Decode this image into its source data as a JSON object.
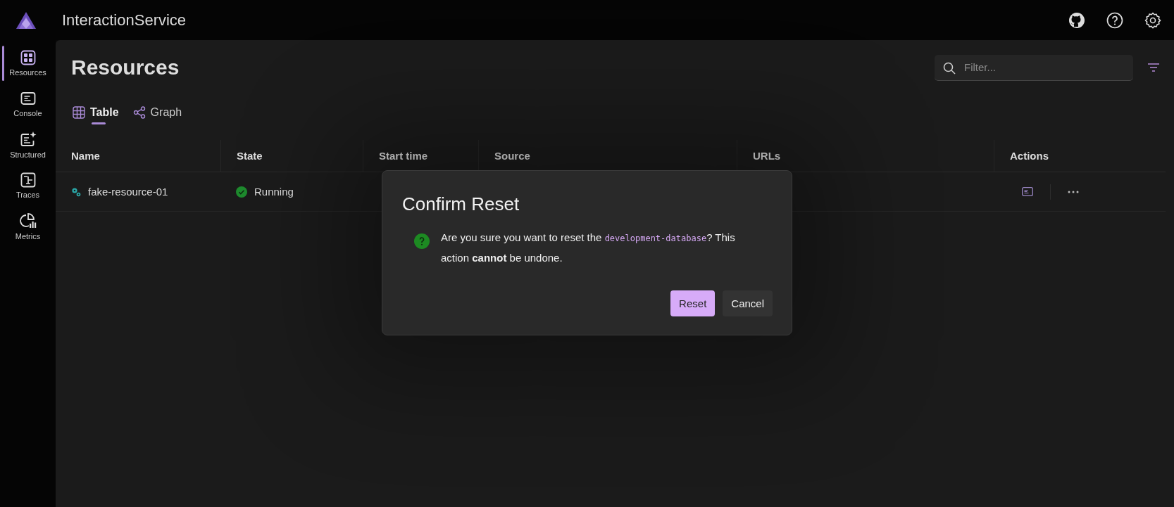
{
  "header": {
    "title": "InteractionService"
  },
  "nav": [
    {
      "label": "Resources",
      "selected": true
    },
    {
      "label": "Console",
      "selected": false
    },
    {
      "label": "Structured",
      "selected": false
    },
    {
      "label": "Traces",
      "selected": false
    },
    {
      "label": "Metrics",
      "selected": false
    }
  ],
  "page": {
    "title": "Resources",
    "filter": {
      "placeholder": "Filter..."
    }
  },
  "views": [
    {
      "label": "Table",
      "selected": true
    },
    {
      "label": "Graph",
      "selected": false
    }
  ],
  "table": {
    "columns": [
      "Name",
      "State",
      "Start time",
      "Source",
      "URLs",
      "Actions"
    ],
    "rows": [
      {
        "name": "fake-resource-01",
        "state": "Running"
      }
    ]
  },
  "dialog": {
    "title": "Confirm Reset",
    "message": [
      {
        "kind": "text",
        "text": "Are you sure you want to reset the "
      },
      {
        "kind": "code",
        "text": "development-database"
      },
      {
        "kind": "text",
        "text": "? This action **cannot** be undone."
      }
    ],
    "buttons": [
      {
        "label": "Reset",
        "kind": "primary"
      },
      {
        "label": "Cancel",
        "kind": "secondary"
      }
    ]
  }
}
